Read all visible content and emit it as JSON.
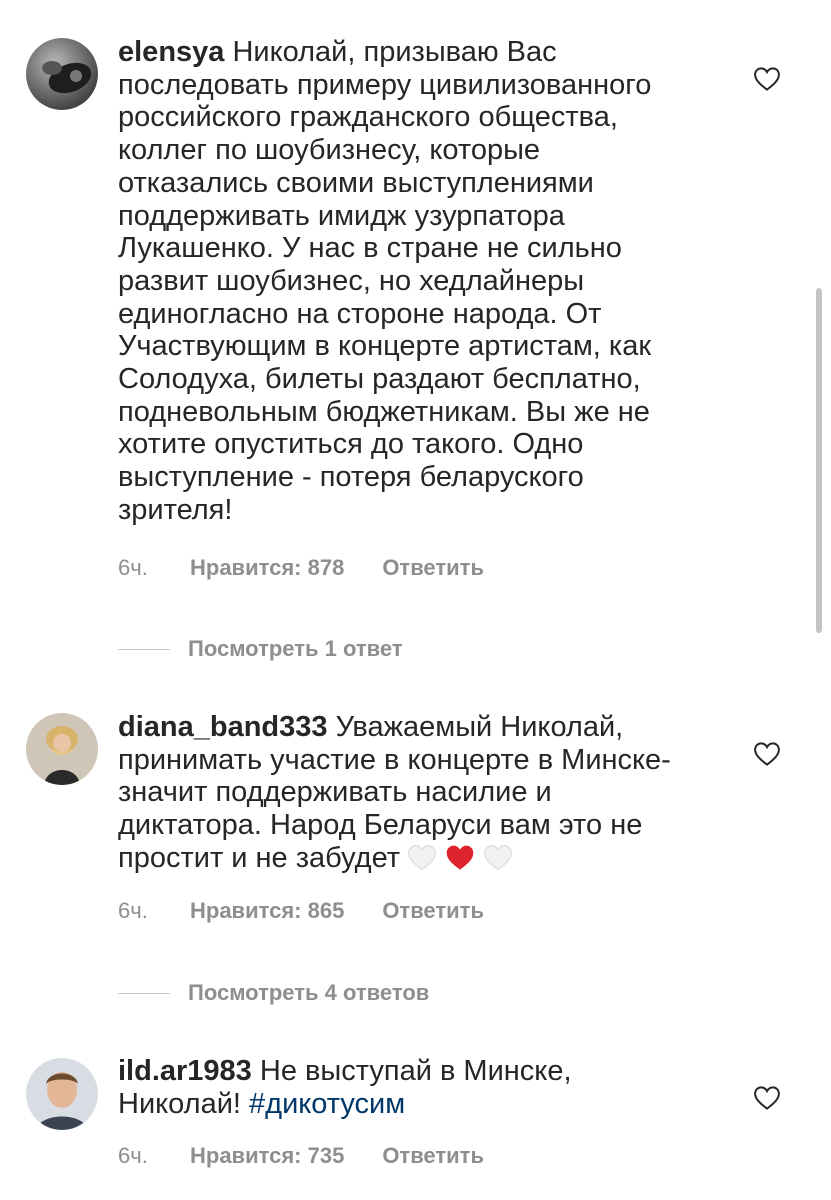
{
  "comments": [
    {
      "username": "elensya",
      "text": "Николай, призываю Вас\nпоследовать примеру цивилизованного\nроссийского гражданского общества,\nколлег по шоубизнесу, которые\nотказались своими выступлениями\nподдерживать имидж узурпатора\nЛукашенко. У нас в стране не сильно\nразвит шоубизнес, но хедлайнеры\nединогласно на стороне народа. От\nУчаствующим в концерте артистам, как\nСолодуха, билеты раздают бесплатно,\nподневольным бюджетникам. Вы же  не\nхотите опуститься до такого. Одно\nвыступление - потеря беларуского\nзрителя!",
      "time": "6ч.",
      "likes": "Нравится: 878",
      "reply": "Ответить",
      "view_replies": "Посмотреть 1 ответ"
    },
    {
      "username": "diana_band333",
      "text": "Уважаемый Николай,\nпринимать участие в концерте в Минске-\nзначит поддерживать насилие и\nдиктатора. Народ Беларуси вам это не\nпростит и не забудет",
      "emojis": [
        "white-heart",
        "red-heart",
        "white-heart"
      ],
      "time": "6ч.",
      "likes": "Нравится: 865",
      "reply": "Ответить",
      "view_replies": "Посмотреть 4 ответов"
    },
    {
      "username": "ild.ar1983",
      "text": "Не выступай в Минске,\nНиколай!",
      "hashtag": "#дикотусим",
      "time": "6ч.",
      "likes": "Нравится: 735",
      "reply": "Ответить"
    }
  ],
  "colors": {
    "text": "#262626",
    "meta": "#8e8e8e",
    "hashtag": "#00376b",
    "heart_red": "#e0242e"
  }
}
